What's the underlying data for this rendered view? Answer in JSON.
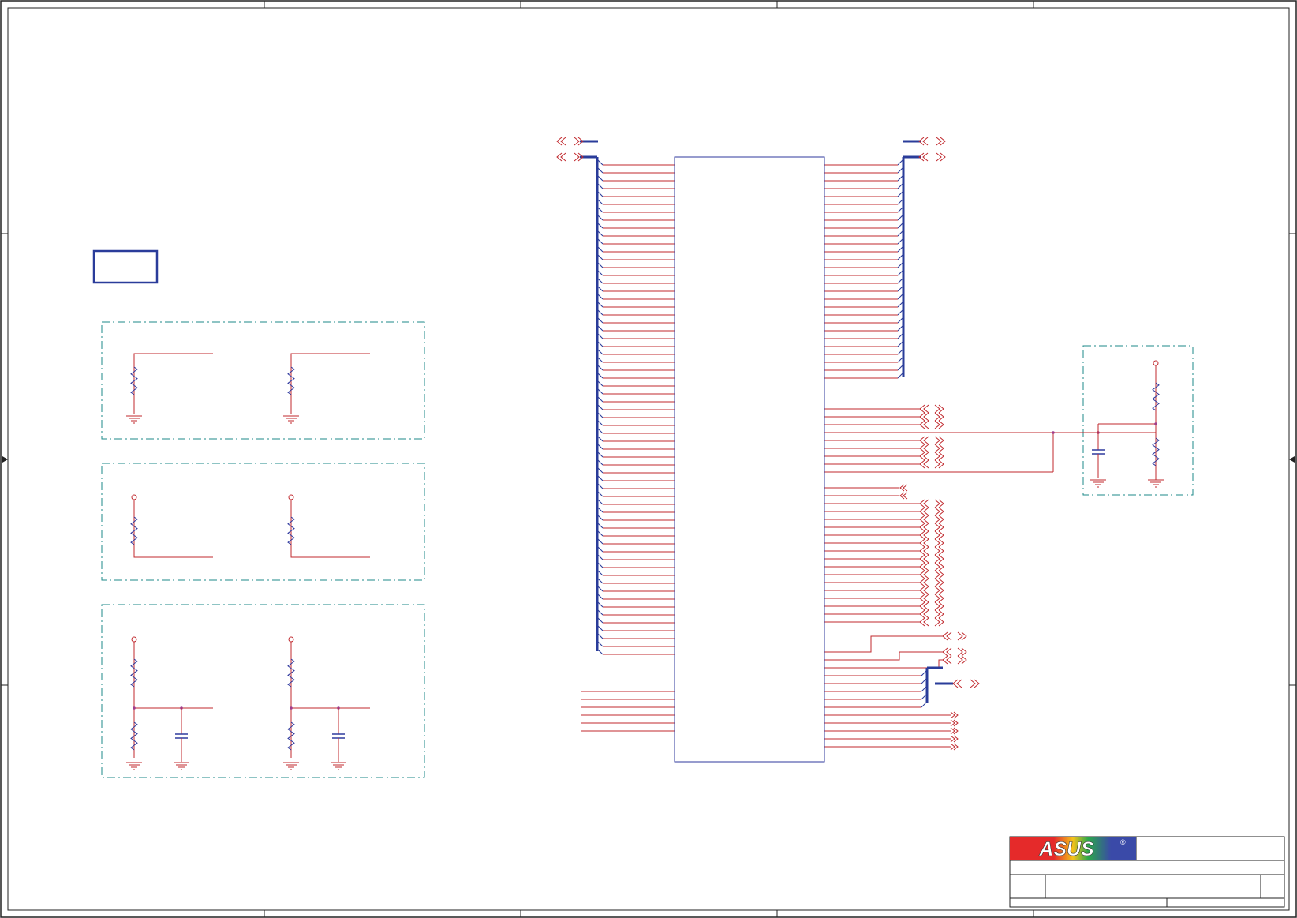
{
  "brand": {
    "logo_text": "ASUS",
    "registered_mark": "®"
  },
  "colors": {
    "border": "#222222",
    "net_wire": "#c0282d",
    "bus": "#2a3c9a",
    "component_body": "#2f3a9e",
    "frame_dashed": "#1e8a8a",
    "junction": "#a03c8c",
    "logo_red": "#e52a2a",
    "logo_blue": "#3a4aa8"
  },
  "schematic": {
    "title_block": {
      "title": "",
      "sheet": "",
      "size": ""
    }
  }
}
